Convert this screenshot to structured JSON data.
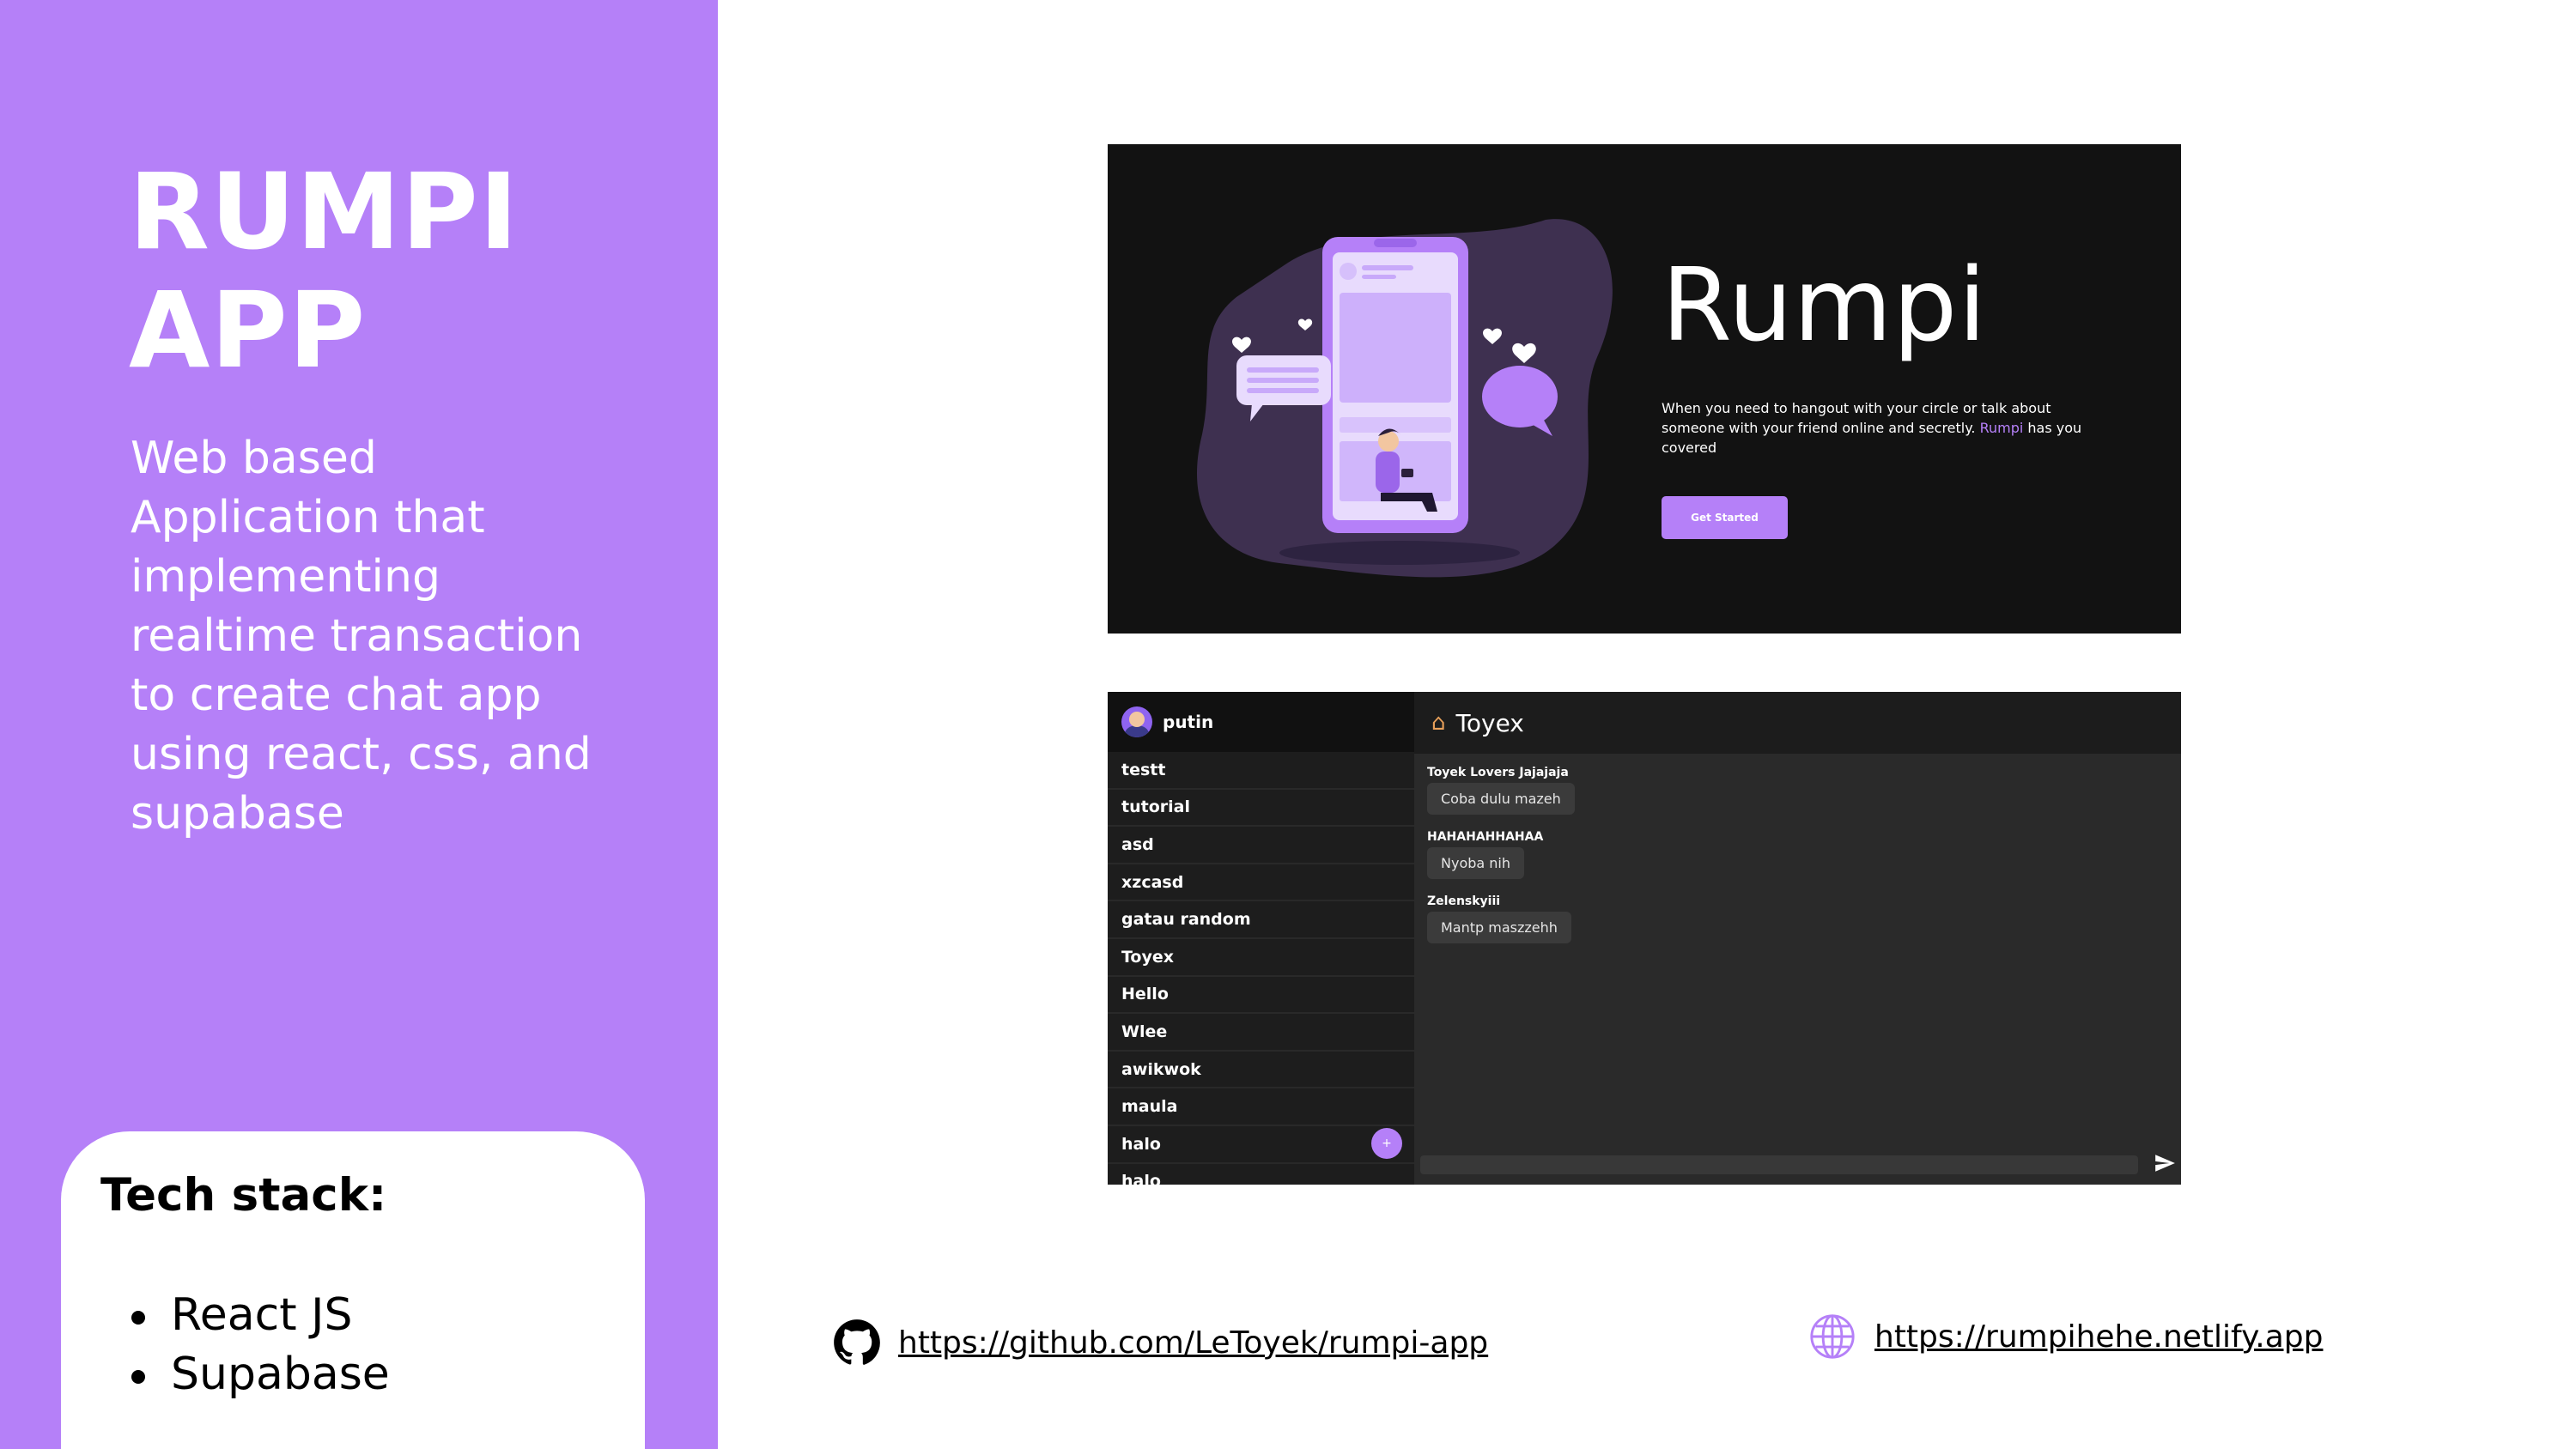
{
  "left": {
    "title_lines": [
      "RUMPI",
      "APP"
    ],
    "description": "Web based Application that implementing realtime transaction to create chat app using react, css, and supabase",
    "tech_title": "Tech stack:",
    "tech_items": [
      "React JS",
      "Supabase"
    ]
  },
  "hero": {
    "title": "Rumpi",
    "text_before": "When you need to hangout with your circle or talk about someone with your friend online and secretly. ",
    "text_highlight": "Rumpi",
    "text_after": " has you covered",
    "button": "Get Started"
  },
  "chat": {
    "user": "putin",
    "rooms": [
      "testt",
      "tutorial",
      "asd",
      "xzcasd",
      "gatau random",
      "Toyex",
      "Hello",
      "Wlee",
      "awikwok",
      "maula",
      "halo",
      "halo"
    ],
    "add_button": "+",
    "room_title": "Toyex",
    "messages": [
      {
        "sender": "Toyek Lovers Jajajaja",
        "text": "Coba dulu mazeh"
      },
      {
        "sender": "HAHAHAHHAHAA",
        "text": "Nyoba nih"
      },
      {
        "sender": "Zelenskyiii",
        "text": "Mantp maszzehh"
      }
    ]
  },
  "links": {
    "github": "https://github.com/LeToyek/rumpi-app",
    "website": "https://rumpihehe.netlify.app"
  },
  "colors": {
    "accent": "#b580f8",
    "hero_bg": "#121212",
    "chat_bg": "#2a2a2a"
  }
}
